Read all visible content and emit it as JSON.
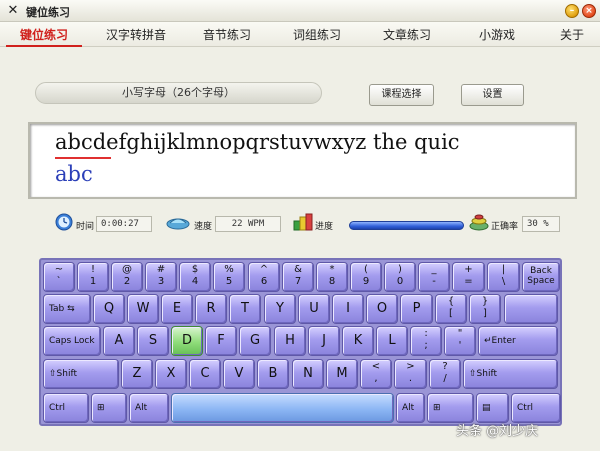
{
  "window": {
    "title": "键位练习",
    "icon": "x-app-icon",
    "min_label": "–",
    "close_label": "×"
  },
  "menu": [
    {
      "label": "键位练习",
      "active": true
    },
    {
      "label": "汉字转拼音"
    },
    {
      "label": "音节练习"
    },
    {
      "label": "词组练习"
    },
    {
      "label": "文章练习"
    },
    {
      "label": "小游戏"
    },
    {
      "label": "关于"
    }
  ],
  "lesson": {
    "label": "小写字母（26个字母）"
  },
  "buttons": {
    "course": "课程选择",
    "settings": "设置"
  },
  "practice": {
    "target": "abcdefghijklmnopqrstuvwxyz the quic",
    "typed": "abc",
    "typed_color": "#2b3fb8",
    "error_color": "#e03030"
  },
  "stats": {
    "time_label": "时间",
    "time_value": "0:00:27",
    "speed_label": "速度",
    "speed_value": "22 WPM",
    "progress_label": "进度",
    "progress_value": 1.0,
    "accuracy_label": "正确率",
    "accuracy_value": "30 %"
  },
  "keyboard": {
    "highlight_color": "#8fdc7a",
    "row1": [
      {
        "top": "~",
        "bot": "`"
      },
      {
        "top": "!",
        "bot": "1"
      },
      {
        "top": "@",
        "bot": "2"
      },
      {
        "top": "#",
        "bot": "3"
      },
      {
        "top": "$",
        "bot": "4"
      },
      {
        "top": "%",
        "bot": "5"
      },
      {
        "top": "^",
        "bot": "6"
      },
      {
        "top": "&",
        "bot": "7"
      },
      {
        "top": "*",
        "bot": "8"
      },
      {
        "top": "(",
        "bot": "9"
      },
      {
        "top": ")",
        "bot": "0"
      },
      {
        "top": "_",
        "bot": "-"
      },
      {
        "top": "+",
        "bot": "="
      },
      {
        "top": "|",
        "bot": "\\"
      },
      {
        "label": "Back\nSpace"
      }
    ],
    "row2": [
      {
        "label": "Tab ⇆"
      },
      {
        "main": "Q"
      },
      {
        "main": "W"
      },
      {
        "main": "E"
      },
      {
        "main": "R"
      },
      {
        "main": "T"
      },
      {
        "main": "Y"
      },
      {
        "main": "U"
      },
      {
        "main": "I"
      },
      {
        "main": "O"
      },
      {
        "main": "P"
      },
      {
        "top": "{",
        "bot": "["
      },
      {
        "top": "}",
        "bot": "]"
      }
    ],
    "row3": [
      {
        "label": "Caps Lock"
      },
      {
        "main": "A"
      },
      {
        "main": "S"
      },
      {
        "main": "D",
        "highlight": true
      },
      {
        "main": "F"
      },
      {
        "main": "G"
      },
      {
        "main": "H"
      },
      {
        "main": "J"
      },
      {
        "main": "K"
      },
      {
        "main": "L"
      },
      {
        "top": ":",
        "bot": ";"
      },
      {
        "top": "\"",
        "bot": "'"
      },
      {
        "label": "↵Enter"
      }
    ],
    "row4": [
      {
        "label": "⇧Shift"
      },
      {
        "main": "Z"
      },
      {
        "main": "X"
      },
      {
        "main": "C"
      },
      {
        "main": "V"
      },
      {
        "main": "B"
      },
      {
        "main": "N"
      },
      {
        "main": "M"
      },
      {
        "top": "<",
        "bot": ","
      },
      {
        "top": ">",
        "bot": "."
      },
      {
        "top": "?",
        "bot": "/"
      },
      {
        "label": "⇧Shift"
      }
    ],
    "row5": [
      {
        "label": "Ctrl"
      },
      {
        "label": "⊞"
      },
      {
        "label": "Alt"
      },
      {
        "label": ""
      },
      {
        "label": "Alt"
      },
      {
        "label": "⊞"
      },
      {
        "label": "▤"
      },
      {
        "label": "Ctrl"
      }
    ]
  },
  "watermark": "头条 @刘少庆"
}
